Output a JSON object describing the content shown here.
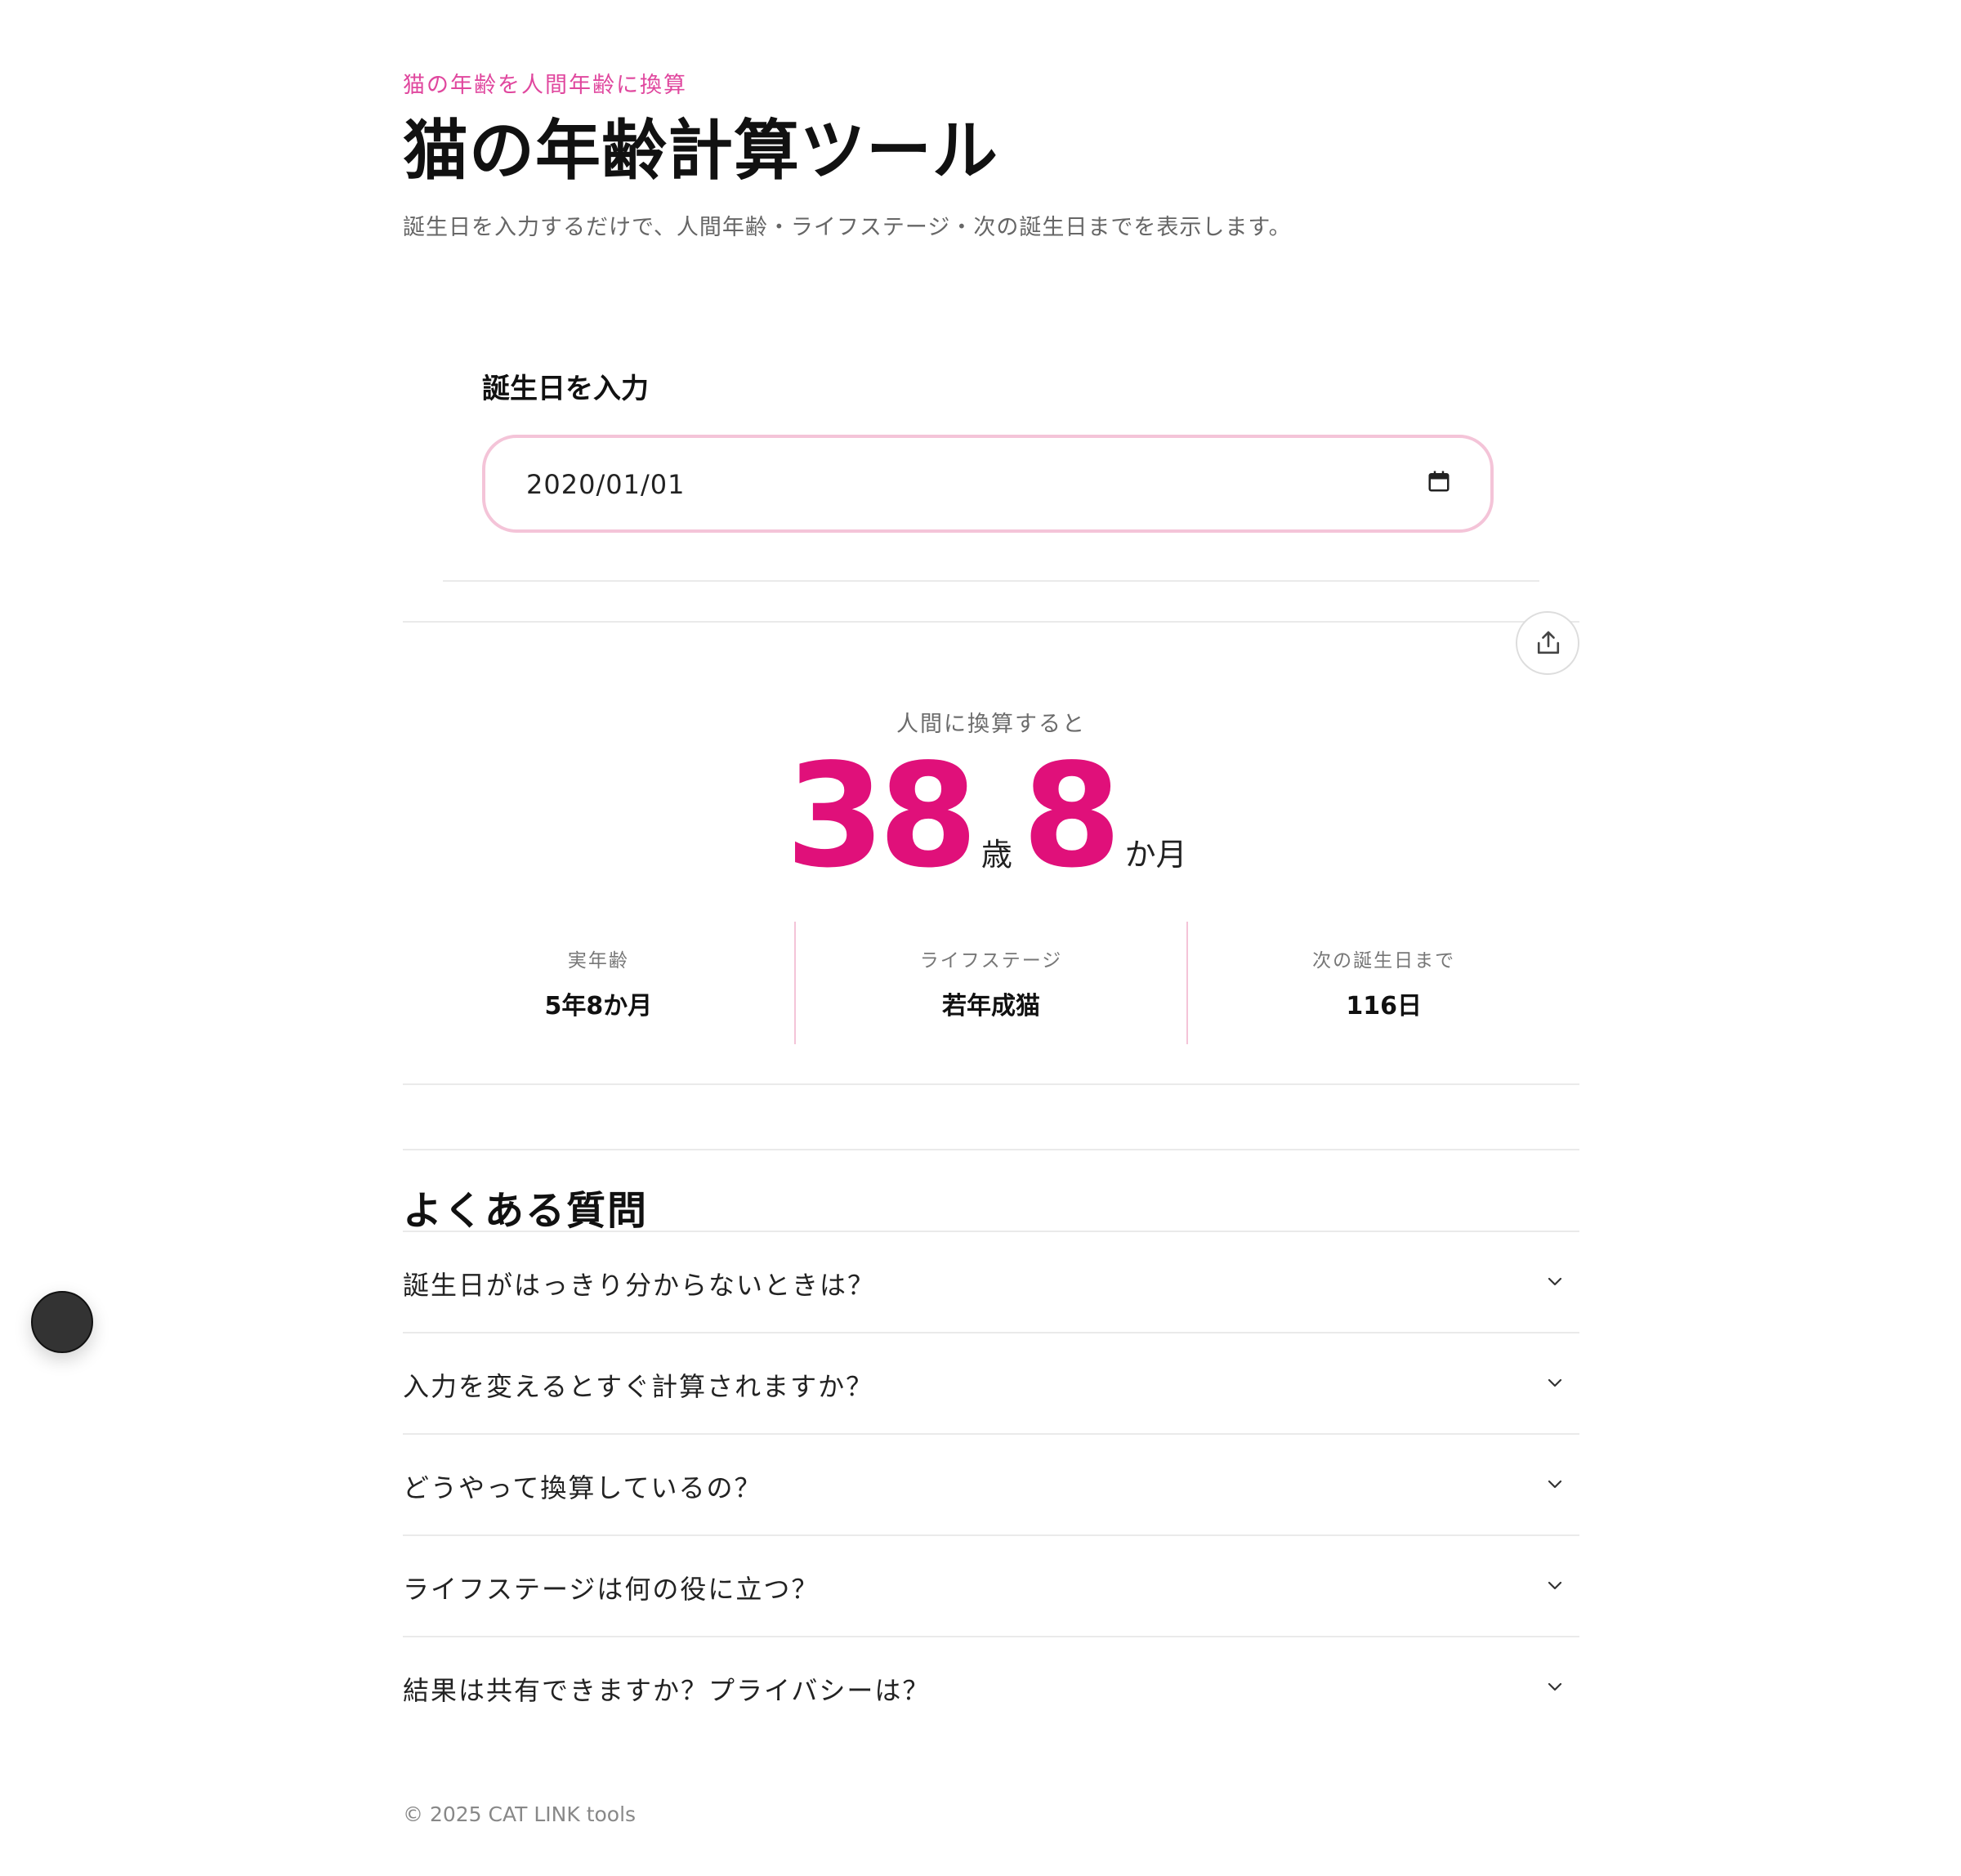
{
  "header": {
    "eyebrow": "猫の年齢を人間年齢に換算",
    "title": "猫の年齢計算ツール",
    "subtitle": "誕生日を入力するだけで、人間年齢・ライフステージ・次の誕生日までを表示します。"
  },
  "input": {
    "label": "誕生日を入力",
    "value": "2020/01/01",
    "icon": "calendar-icon"
  },
  "result": {
    "caption": "人間に換算すると",
    "years": "38",
    "years_unit": "歳",
    "months": "8",
    "months_unit": "か月",
    "share_icon": "share-icon",
    "stats": [
      {
        "label": "実年齢",
        "value": "5年8か月"
      },
      {
        "label": "ライフステージ",
        "value": "若年成猫"
      },
      {
        "label": "次の誕生日まで",
        "value": "116日"
      }
    ]
  },
  "faq": {
    "title": "よくある質問",
    "items": [
      {
        "question": "誕生日がはっきり分からないときは？"
      },
      {
        "question": "入力を変えるとすぐ計算されますか？"
      },
      {
        "question": "どうやって換算しているの？"
      },
      {
        "question": "ライフステージは何の役に立つ？"
      },
      {
        "question": "結果は共有できますか？プライバシーは？"
      }
    ]
  },
  "footer": {
    "text": "© 2025 CAT LINK tools"
  },
  "colors": {
    "accent": "#e0107a",
    "eyebrow": "#e0479e",
    "input_border": "#f4c4d8",
    "divider": "#eaeaea"
  }
}
